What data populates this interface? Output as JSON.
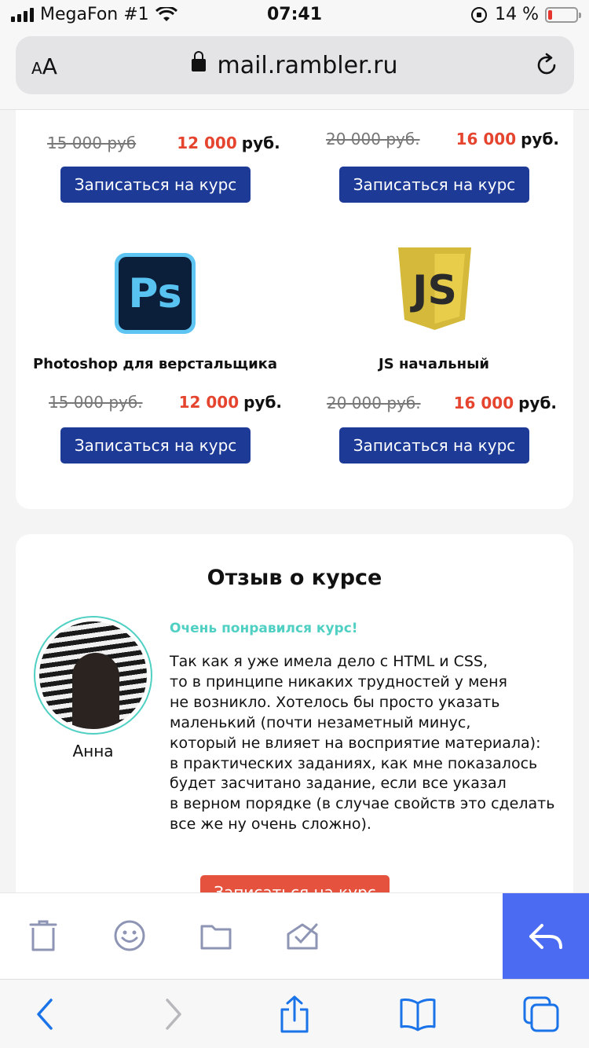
{
  "status_bar": {
    "carrier": "MegaFon #1",
    "time": "07:41",
    "battery_percent_label": "14 %",
    "battery_level": 0.14,
    "battery_color": "#e5352c"
  },
  "browser": {
    "text_size_label_small": "A",
    "text_size_label_large": "A",
    "url": "mail.rambler.ru",
    "icons": [
      "lock-icon",
      "reload-icon"
    ]
  },
  "courses_top": [
    {
      "old_price": "15 000 руб",
      "new_price": "12 000",
      "currency": "руб.",
      "button": "Записаться на курс"
    },
    {
      "old_price": "20 000 руб.",
      "new_price": "16 000",
      "currency": "руб.",
      "button": "Записаться на курс"
    }
  ],
  "courses": [
    {
      "title": "Photoshop для верстальщика",
      "logo_text": "Ps",
      "icon": "photoshop-logo-icon",
      "old_price": "15 000 руб.",
      "new_price": "12 000",
      "currency": "руб.",
      "button": "Записаться на курс"
    },
    {
      "title": "JS начальный",
      "logo_text": "JS",
      "icon": "javascript-logo-icon",
      "old_price": "20 000 руб.",
      "new_price": "16 000",
      "currency": "руб.",
      "button": "Записаться на курс"
    }
  ],
  "review": {
    "heading": "Отзыв о курсе",
    "reviewer_name": "Анна",
    "title": "Очень понравился курс!",
    "text": "Так как я уже имела дело с HTML и CSS,\nто в принципе никаких трудностей у меня\nне возникло. Хотелось бы просто указать\nмаленький (почти незаметный минус,\nкоторый не влияет на восприятие материала):\nв практических заданиях, как мне показалось\nбудет засчитано задание, если все указал\nв верном порядке (в случае свойств это сделать\nвсе же ну очень сложно).",
    "cta_button": "Записаться на курс"
  },
  "mail_toolbar": {
    "icons": [
      "trash-icon",
      "emoji-icon",
      "folder-icon",
      "mark-done-icon",
      "reply-icon"
    ],
    "accent": "#4b6bf2",
    "icon_color": "#8e95b4"
  },
  "safari_toolbar": {
    "icons": [
      "back-icon",
      "forward-icon",
      "share-icon",
      "bookmarks-icon",
      "tabs-icon"
    ],
    "accent": "#1a73e8"
  },
  "colors": {
    "button_blue": "#1c3a96",
    "price_red": "#e5442f",
    "teal": "#4fd0c3",
    "cta_red": "#e5533e"
  }
}
